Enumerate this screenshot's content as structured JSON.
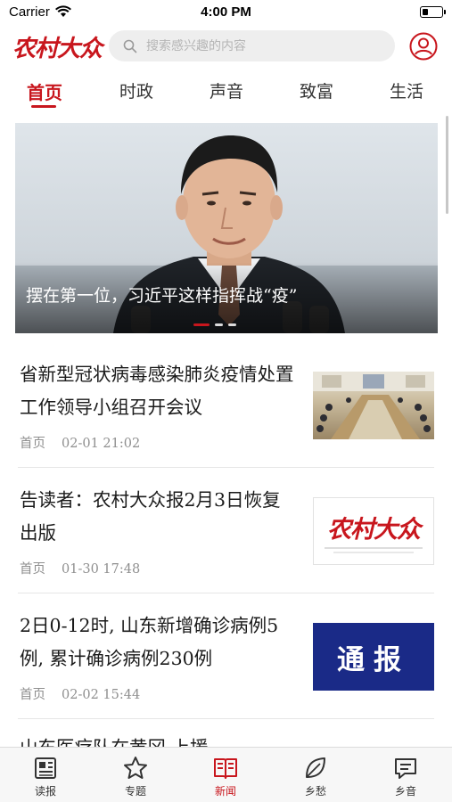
{
  "status_bar": {
    "carrier": "Carrier",
    "time": "4:00 PM",
    "battery_level": 0.3
  },
  "header": {
    "logo": "农村大众",
    "search": {
      "placeholder": "搜索感兴趣的内容"
    }
  },
  "tabs": [
    {
      "label": "首页",
      "active": true
    },
    {
      "label": "时政",
      "active": false
    },
    {
      "label": "声音",
      "active": false
    },
    {
      "label": "致富",
      "active": false
    },
    {
      "label": "生活",
      "active": false
    }
  ],
  "banner": {
    "caption": "摆在第一位，习近平这样指挥战“疫”",
    "slide_index": 1,
    "slide_count": 3
  },
  "news": [
    {
      "title": "省新型冠状病毒感染肺炎疫情处置工作领导小组召开会议",
      "channel": "首页",
      "date": "02-01 21:02",
      "thumb": "meeting-photo"
    },
    {
      "title": "告读者：农村大众报2月3日恢复出版",
      "channel": "首页",
      "date": "01-30 17:48",
      "thumb": "newspaper-logo",
      "thumb_text": "农村大众"
    },
    {
      "title": "2日0-12时, 山东新增确诊病例5例, 累计确诊病例230例",
      "channel": "首页",
      "date": "02-02 15:44",
      "thumb": "notice-banner",
      "thumb_text": "通报"
    }
  ],
  "partial_item": {
    "title": "山东医疗队在黄冈 上援"
  },
  "tabbar": [
    {
      "label": "读报",
      "icon": "newspaper-icon",
      "active": false
    },
    {
      "label": "专题",
      "icon": "star-icon",
      "active": false
    },
    {
      "label": "新闻",
      "icon": "book-icon",
      "active": true
    },
    {
      "label": "乡愁",
      "icon": "leaf-icon",
      "active": false
    },
    {
      "label": "乡音",
      "icon": "chat-icon",
      "active": false
    }
  ],
  "colors": {
    "brand_red": "#c8161d",
    "notice_blue": "#1a2a87"
  }
}
